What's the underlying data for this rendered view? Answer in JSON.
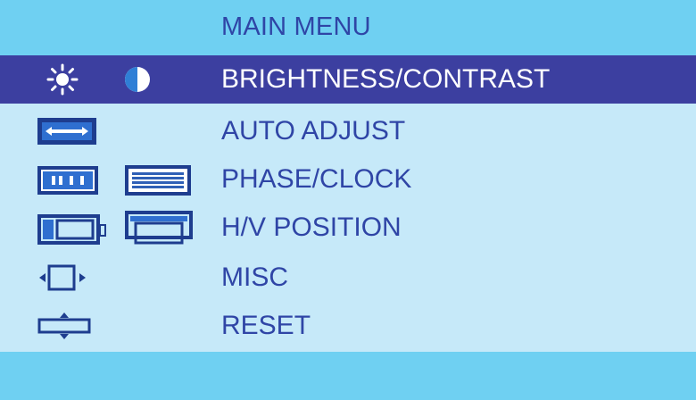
{
  "menu": {
    "title": "MAIN MENU",
    "selected_index": 0,
    "items": [
      {
        "label": "BRIGHTNESS/CONTRAST",
        "icons": [
          "sun-icon",
          "contrast-icon"
        ]
      },
      {
        "label": "AUTO ADJUST",
        "icons": [
          "auto-adjust-icon"
        ]
      },
      {
        "label": "PHASE/CLOCK",
        "icons": [
          "phase-icon",
          "clock-icon"
        ]
      },
      {
        "label": "H/V POSITION",
        "icons": [
          "h-position-icon",
          "v-position-icon"
        ]
      },
      {
        "label": "MISC",
        "icons": [
          "misc-icon"
        ]
      },
      {
        "label": "RESET",
        "icons": [
          "reset-icon"
        ]
      }
    ]
  },
  "colors": {
    "header_bg": "#6fd0f2",
    "body_bg": "#c6e9f9",
    "selected_bg": "#3c3fa0",
    "text": "#2f45a6",
    "selected_text": "#ffffff"
  }
}
